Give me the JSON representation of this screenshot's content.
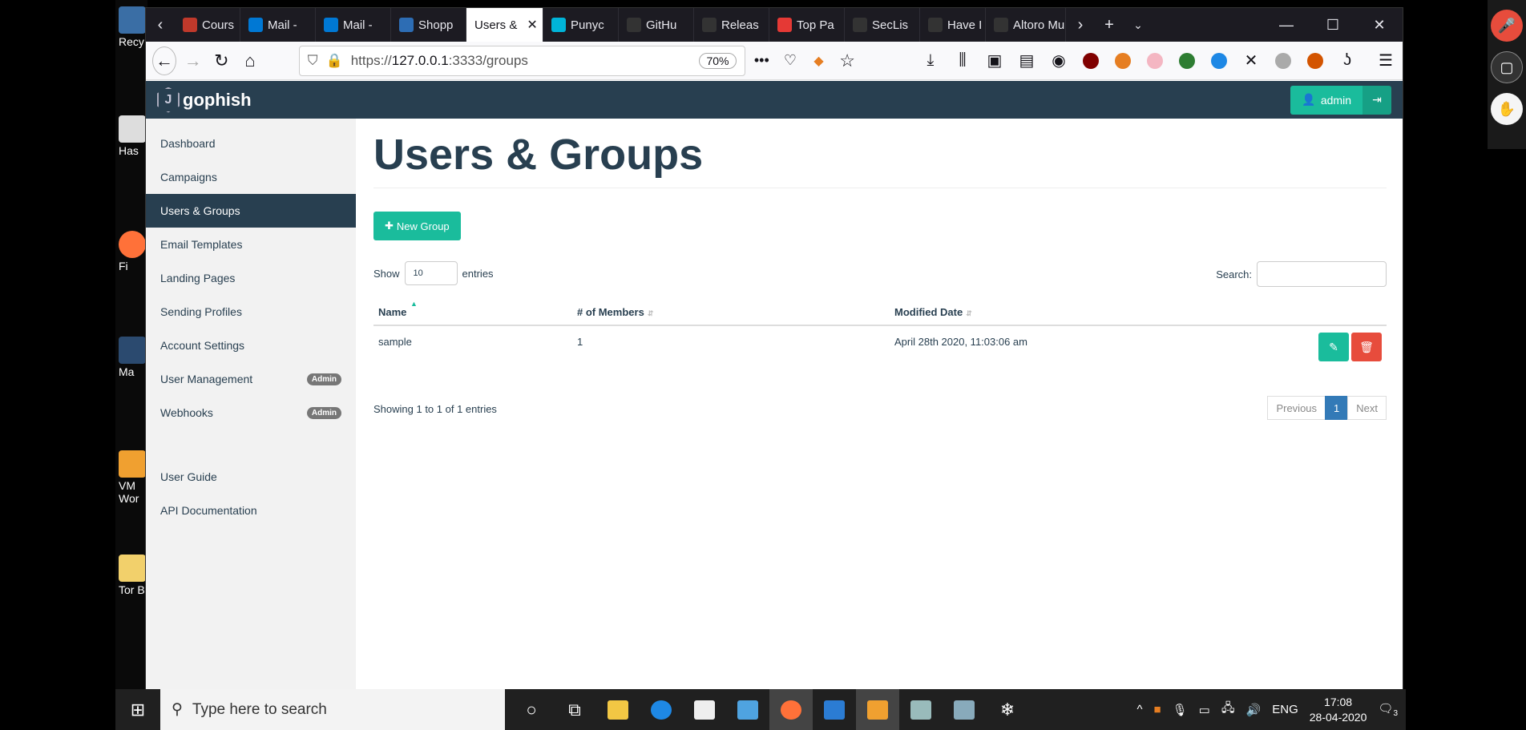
{
  "desktop": {
    "icons": [
      "Recy",
      "Has",
      "Fi",
      "Ma",
      "VM\nWor",
      "Tor B"
    ]
  },
  "browser": {
    "tabs": [
      {
        "label": "Cours",
        "color": "#c0392b"
      },
      {
        "label": "Mail -",
        "color": "#0078d4"
      },
      {
        "label": "Mail -",
        "color": "#0078d4"
      },
      {
        "label": "Shopp",
        "color": "#2d6db4"
      },
      {
        "label": "Users &",
        "color": "#ffffff",
        "active": true
      },
      {
        "label": "Punyc",
        "color": "#00b4d8"
      },
      {
        "label": "GitHu",
        "color": "#333333"
      },
      {
        "label": "Releas",
        "color": "#333333"
      },
      {
        "label": "Top Pa",
        "color": "#e53935"
      },
      {
        "label": "SecLis",
        "color": "#333333"
      },
      {
        "label": "Have I",
        "color": "#333333"
      },
      {
        "label": "Altoro Mu",
        "color": "#333333"
      }
    ],
    "url_prefix": "https://",
    "url_host": "127.0.0.1",
    "url_rest": ":3333/groups",
    "zoom": "70%"
  },
  "app": {
    "logo_text": "gophish",
    "admin_label": "admin",
    "sidebar": [
      {
        "label": "Dashboard"
      },
      {
        "label": "Campaigns"
      },
      {
        "label": "Users & Groups",
        "active": true
      },
      {
        "label": "Email Templates"
      },
      {
        "label": "Landing Pages"
      },
      {
        "label": "Sending Profiles"
      },
      {
        "label": "Account Settings"
      },
      {
        "label": "User Management",
        "badge": "Admin"
      },
      {
        "label": "Webhooks",
        "badge": "Admin"
      }
    ],
    "sidebar_bottom": [
      {
        "label": "User Guide"
      },
      {
        "label": "API Documentation"
      }
    ],
    "page_title": "Users & Groups",
    "new_group_label": "New Group",
    "show_label": "Show",
    "entries_value": "10",
    "entries_label": "entries",
    "search_label": "Search:",
    "table": {
      "headers": [
        "Name",
        "# of Members",
        "Modified Date"
      ],
      "rows": [
        {
          "name": "sample",
          "members": "1",
          "modified": "April 28th 2020, 11:03:06 am"
        }
      ]
    },
    "info_text": "Showing 1 to 1 of 1 entries",
    "pager": {
      "previous": "Previous",
      "current": "1",
      "next": "Next"
    }
  },
  "taskbar": {
    "search_placeholder": "Type here to search",
    "language": "ENG",
    "time": "17:08",
    "date": "28-04-2020",
    "notification_count": "3"
  }
}
